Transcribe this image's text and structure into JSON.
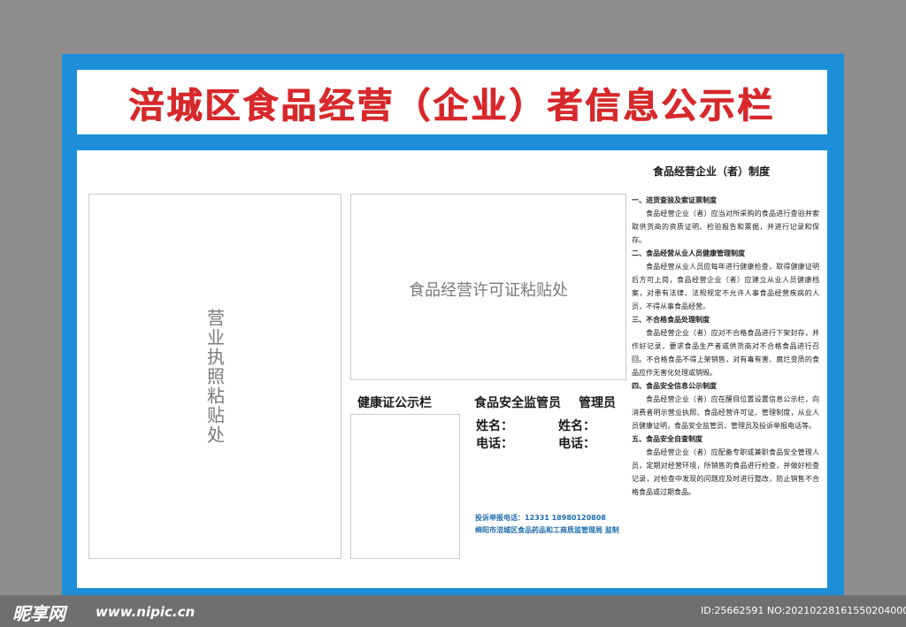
{
  "title": "涪城区食品经营（企业）者信息公示栏",
  "business_license": "营业执照粘贴处",
  "food_license": "食品经营许可证粘贴处",
  "health_cert_title": "健康证公示栏",
  "supervisor": {
    "header": "食品安全监管员",
    "header2": "管理员",
    "name_label_1": "姓名：",
    "name_label_2": "姓名：",
    "phone_label_1": "电话：",
    "phone_label_2": "电话："
  },
  "complaint": {
    "line1": "投诉举报电话：12331  18980120808",
    "line2": "绵阳市涪城区食品药品和工商质监管理局 监制"
  },
  "rules": {
    "title": "食品经营企业（者）制度",
    "sections": [
      {
        "heading": "一、进货查验及索证票制度",
        "body": "食品经营企业（者）应当对所采购的食品进行查验并索取供货商的资质证明、检验报告和票据，并进行记录和保存。"
      },
      {
        "heading": "二、食品经营从业人员健康管理制度",
        "body": "食品经营从业人员应每年进行健康检查，取得健康证明后方可上岗，食品经营企业（者）应建立从业人员健康档案，对患有法律、法规规定不允许人事食品经营疾病的人员，不得从事食品经营。"
      },
      {
        "heading": "三、不合格食品处理制度",
        "body": "食品经营企业（者）应对不合格食品进行下架封存，并作好记录，要求食品生产者或供货商对不合格食品进行召回。不合格食品不得上架销售，对有毒有害、腐烂变质的食品应作无害化处理或销毁。"
      },
      {
        "heading": "四、食品安全信息公示制度",
        "body": "食品经营企业（者）应在醒目位置设置信息公示栏，向消费者明示营业执照、食品经营许可证、管理制度，从业人员健康证明，食品安全监管员、管理员及投诉举报电话等。"
      },
      {
        "heading": "五、食品安全自查制度",
        "body": "食品经营企业（者）应配备专职或兼职食品安全管理人员，定期对经营环境，所销售的食品进行检查，并做好检查记录，对检查中发现的问题应及时进行整改，防止销售不合格食品或过期食品。"
      }
    ]
  },
  "watermark": {
    "logo": "昵享网",
    "url": "www.nipic.cn",
    "id": "ID:25662591 NO:20210228161550204000"
  },
  "colors": {
    "background": "#8e8e8e",
    "board_blue": "#1c8fd8",
    "title_red": "#d7282b",
    "complaint_blue": "#1f6db0"
  }
}
